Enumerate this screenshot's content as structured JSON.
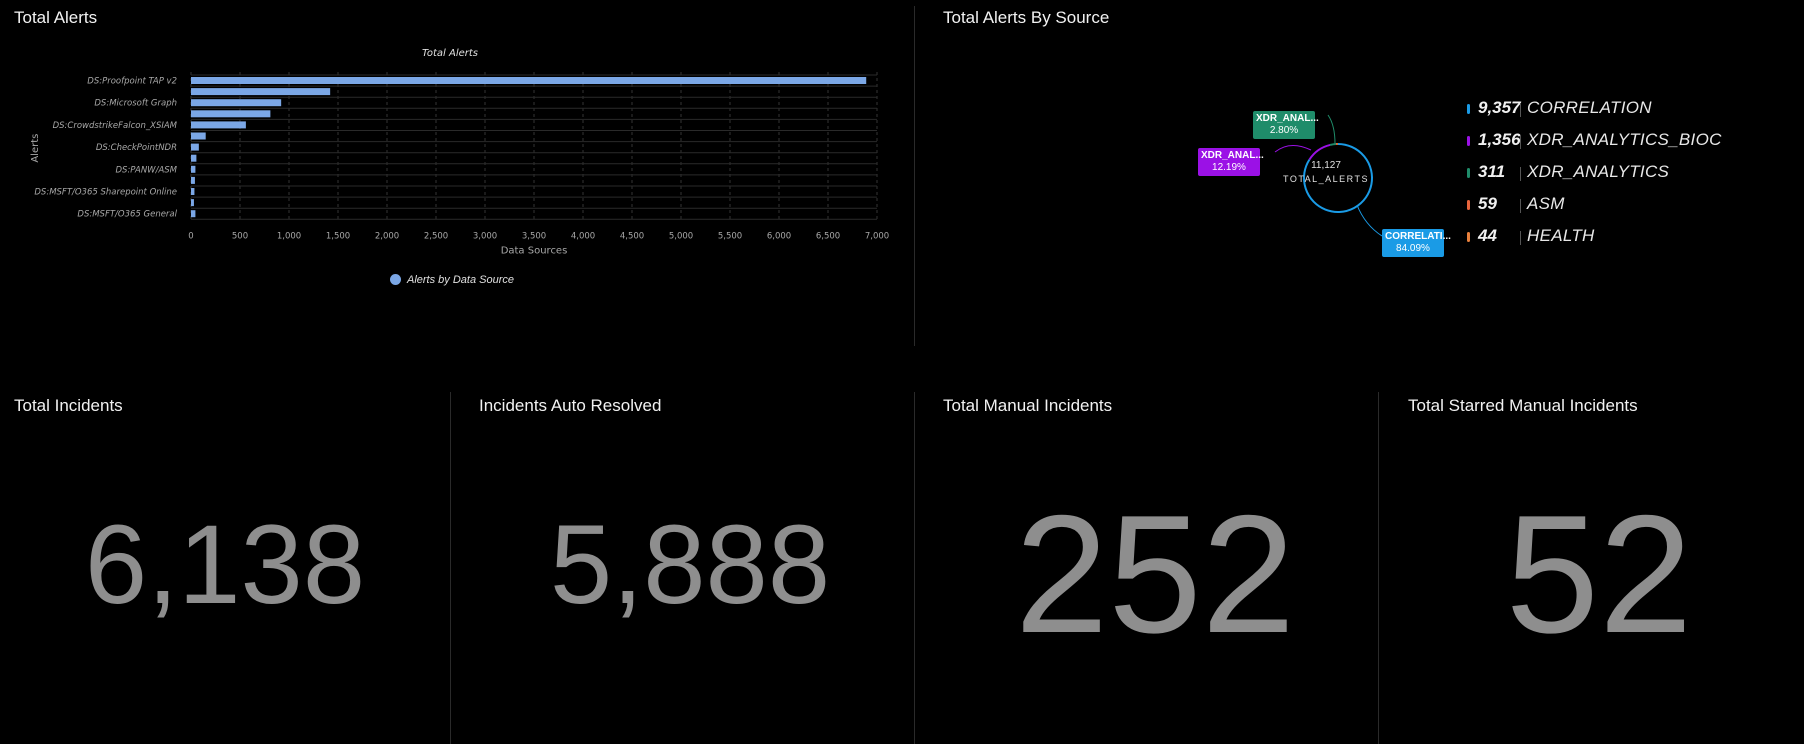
{
  "panels": {
    "total_alerts": {
      "title": "Total Alerts"
    },
    "alerts_by_source": {
      "title": "Total Alerts By Source"
    },
    "total_incidents": {
      "title": "Total Incidents",
      "value": "6,138"
    },
    "auto_resolved": {
      "title": "Incidents Auto Resolved",
      "value": "5,888"
    },
    "manual_incidents": {
      "title": "Total Manual Incidents",
      "value": "252"
    },
    "starred_manual": {
      "title": "Total Starred Manual Incidents",
      "value": "52"
    }
  },
  "chart_data": [
    {
      "type": "bar",
      "orientation": "horizontal",
      "title": "Total Alerts",
      "xlabel": "Data Sources",
      "ylabel": "Alerts",
      "xlim": [
        0,
        7000
      ],
      "xticks": [
        "0",
        "500",
        "1,000",
        "1,500",
        "2,000",
        "2,500",
        "3,000",
        "3,500",
        "4,000",
        "4,500",
        "5,000",
        "5,500",
        "6,000",
        "6,500",
        "7,000"
      ],
      "categories": [
        "DS:Proofpoint TAP v2",
        "",
        "DS:Microsoft Graph",
        "",
        "DS:CrowdstrikeFalcon_XSIAM",
        "",
        "DS:CheckPointNDR",
        "",
        "DS:PANW/ASM",
        "",
        "DS:MSFT/O365 Sharepoint Online",
        "",
        "DS:MSFT/O365 General"
      ],
      "series": [
        {
          "name": "Alerts by Data Source",
          "values": [
            6890,
            1420,
            920,
            810,
            560,
            150,
            80,
            55,
            45,
            40,
            35,
            30,
            45
          ]
        }
      ],
      "grid": true,
      "legend": "bottom",
      "color": "#7ba7e6"
    },
    {
      "type": "pie",
      "variant": "donut",
      "center_value": "11,127",
      "center_label": "TOTAL_ALERTS",
      "slices": [
        {
          "label": "CORRELATION",
          "value": 9357,
          "display_value": "9,357",
          "percent": "84.09%",
          "tag": "CORRELATI...",
          "color": "#1a9be6"
        },
        {
          "label": "XDR_ANALYTICS_BIOC",
          "value": 1356,
          "display_value": "1,356",
          "percent": "12.19%",
          "tag": "XDR_ANAL...",
          "color": "#9b11e6"
        },
        {
          "label": "XDR_ANALYTICS",
          "value": 311,
          "display_value": "311",
          "percent": "2.80%",
          "tag": "XDR_ANAL...",
          "color": "#1f8c6a"
        },
        {
          "label": "ASM",
          "value": 59,
          "display_value": "59",
          "color": "#e8643c"
        },
        {
          "label": "HEALTH",
          "value": 44,
          "display_value": "44",
          "color": "#e8803c"
        }
      ],
      "legend": "right"
    }
  ]
}
